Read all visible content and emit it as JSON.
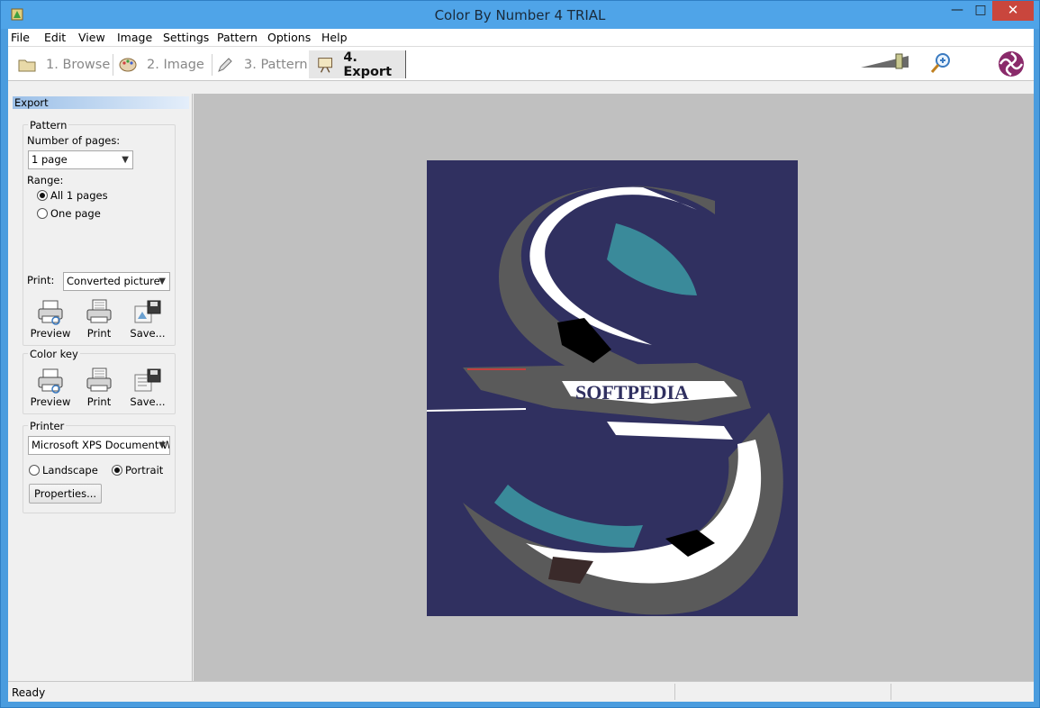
{
  "window": {
    "title": "Color By Number 4 TRIAL"
  },
  "menu": [
    "File",
    "Edit",
    "View",
    "Image",
    "Settings",
    "Pattern",
    "Options",
    "Help"
  ],
  "steps": [
    {
      "label": "1. Browse",
      "icon": "folder-icon"
    },
    {
      "label": "2. Image",
      "icon": "palette-icon"
    },
    {
      "label": "3. Pattern",
      "icon": "pencil-icon"
    },
    {
      "label": "4. Export",
      "icon": "easel-icon",
      "active": true
    }
  ],
  "panel": {
    "header": "Export",
    "pattern": {
      "title": "Pattern",
      "pages_label": "Number of pages:",
      "pages_value": "1 page",
      "range_label": "Range:",
      "range_all": "All 1 pages",
      "range_one": "One page",
      "print_label": "Print:",
      "print_value": "Converted picture",
      "buttons": {
        "preview": "Preview",
        "print": "Print",
        "save": "Save..."
      }
    },
    "color_key": {
      "title": "Color key",
      "buttons": {
        "preview": "Preview",
        "print": "Print",
        "save": "Save..."
      }
    },
    "printer": {
      "title": "Printer",
      "device": "Microsoft XPS Document Wri",
      "landscape": "Landscape",
      "portrait": "Portrait",
      "properties": "Properties..."
    }
  },
  "picture": {
    "text": "SOFTPEDIA",
    "colors": {
      "background": "#303060",
      "teal": "#3a8a9a",
      "gray": "#5a5a5a",
      "white": "#ffffff",
      "dark": "#000000"
    }
  },
  "status": {
    "text": "Ready"
  },
  "colors": {
    "titlebar": "#4fa4e8",
    "close": "#c9463d",
    "canvas": "#c0c0c0"
  }
}
